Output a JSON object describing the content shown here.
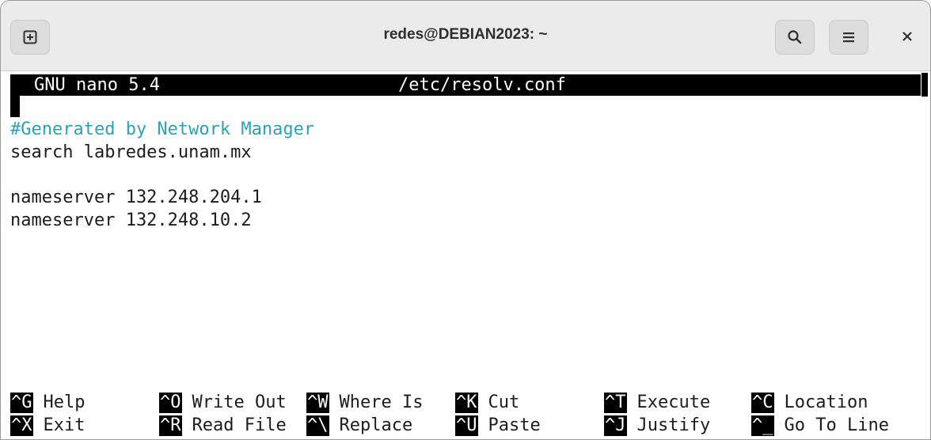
{
  "window": {
    "title": "redes@DEBIAN2023: ~"
  },
  "nano": {
    "version": "GNU nano 5.4",
    "filename": "/etc/resolv.conf"
  },
  "file_lines": [
    "#Generated by Network Manager",
    "search labredes.unam.mx",
    "",
    "nameserver 132.248.204.1",
    "nameserver 132.248.10.2"
  ],
  "shortcuts": {
    "row1": [
      {
        "key": "^G",
        "label": "Help"
      },
      {
        "key": "^O",
        "label": "Write Out"
      },
      {
        "key": "^W",
        "label": "Where Is"
      },
      {
        "key": "^K",
        "label": "Cut"
      },
      {
        "key": "^T",
        "label": "Execute"
      },
      {
        "key": "^C",
        "label": "Location"
      }
    ],
    "row2": [
      {
        "key": "^X",
        "label": "Exit"
      },
      {
        "key": "^R",
        "label": "Read File"
      },
      {
        "key": "^\\",
        "label": "Replace"
      },
      {
        "key": "^U",
        "label": "Paste"
      },
      {
        "key": "^J",
        "label": "Justify"
      },
      {
        "key": "^_",
        "label": "Go To Line"
      }
    ]
  },
  "icons": {
    "new_tab": "new-tab-icon",
    "search": "search-icon",
    "menu": "hamburger-menu-icon",
    "close": "close-icon"
  },
  "colors": {
    "comment": "#2aa3b5",
    "header_bg": "#000000",
    "titlebar_bg": "#ebebeb"
  }
}
